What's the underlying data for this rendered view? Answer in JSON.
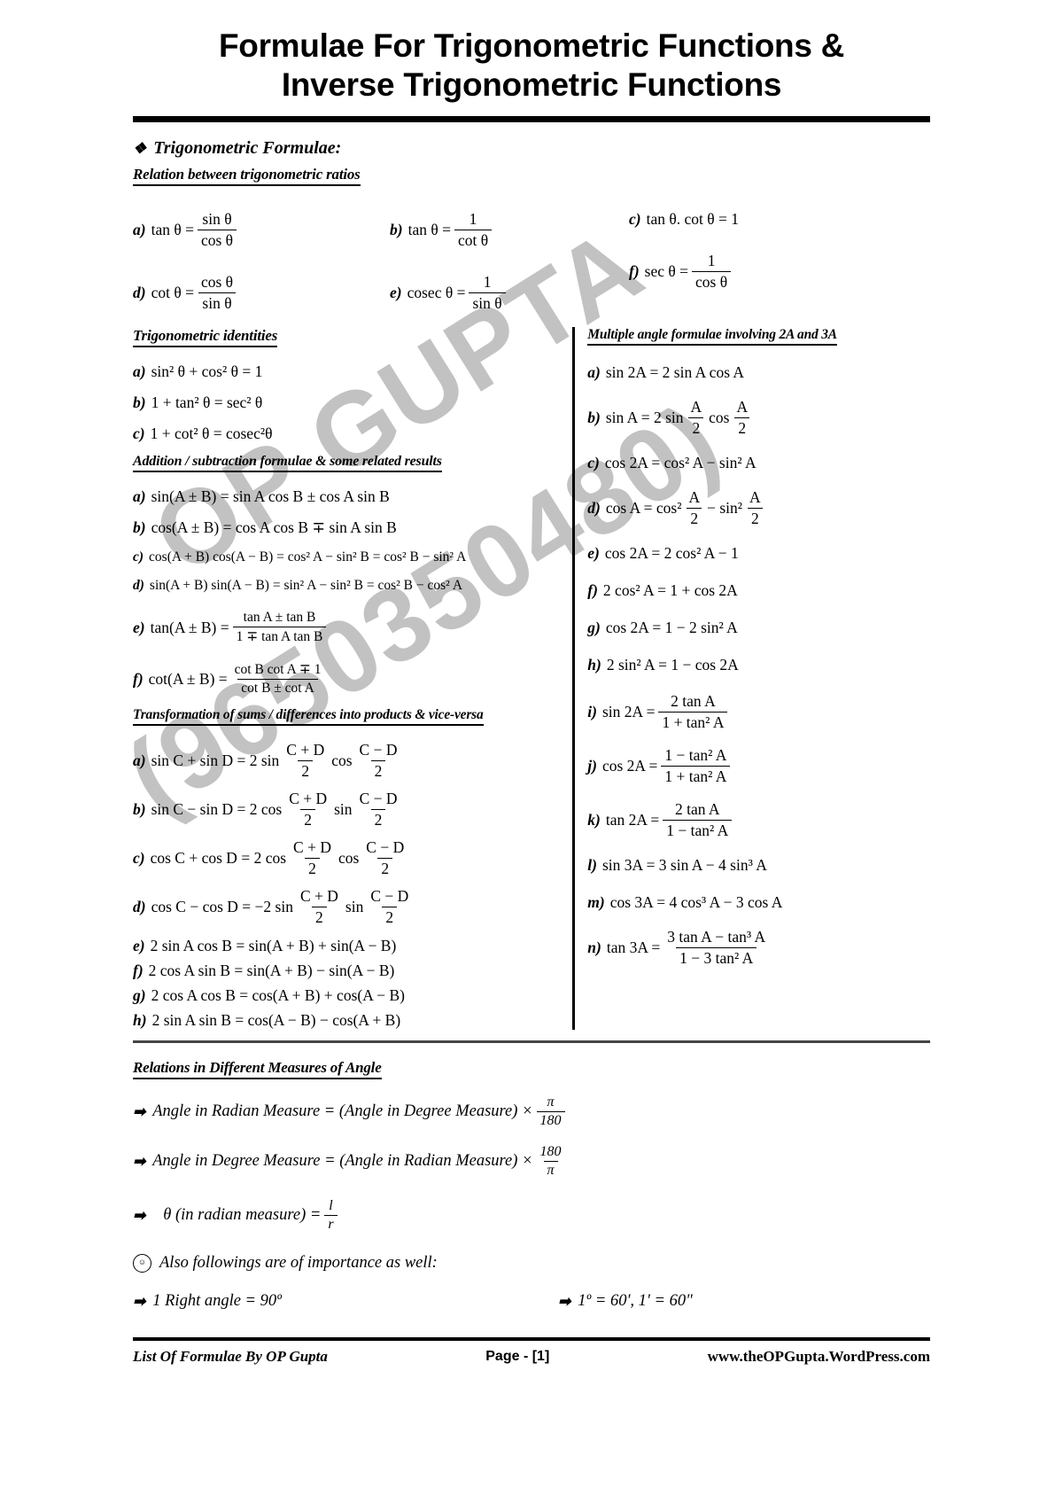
{
  "document": {
    "title_line1": "Formulae For Trigonometric Functions &",
    "title_line2": "Inverse Trigonometric Functions"
  },
  "section_main": {
    "heading": "Trigonometric Formulae:",
    "bullet_glyph": "❖"
  },
  "relations": {
    "subhead": "Relation between trigonometric ratios",
    "items": [
      {
        "label": "a)",
        "lhs": "tan θ =",
        "num": "sin θ",
        "den": "cos θ"
      },
      {
        "label": "b)",
        "lhs": "tan θ =",
        "num": "1",
        "den": "cot θ"
      },
      {
        "label": "c)",
        "plain": "tan θ. cot θ = 1"
      },
      {
        "label": "d)",
        "lhs": "cot θ =",
        "num": "cos θ",
        "den": "sin θ"
      },
      {
        "label": "e)",
        "lhs": "cosec θ =",
        "num": "1",
        "den": "sin θ"
      },
      {
        "label": "f)",
        "lhs": "sec θ =",
        "num": "1",
        "den": "cos θ"
      }
    ]
  },
  "identities": {
    "subhead": "Trigonometric identities",
    "items": [
      {
        "label": "a)",
        "text_html": "sin² θ + cos² θ = 1"
      },
      {
        "label": "b)",
        "text_html": "1 + tan² θ = sec² θ"
      },
      {
        "label": "c)",
        "text_html": "1 + cot² θ = cosec²θ"
      }
    ]
  },
  "addition": {
    "subhead": "Addition / subtraction formulae  & some related results",
    "items": [
      {
        "label": "a)",
        "text": "sin(A ± B) = sin A cos B ± cos A sin B"
      },
      {
        "label": "b)",
        "text": "cos(A ± B) = cos A cos B ∓ sin A sin B"
      },
      {
        "label": "c)",
        "text": "cos(A + B) cos(A − B) = cos² A − sin² B = cos² B − sin² A"
      },
      {
        "label": "d)",
        "text": "sin(A + B) sin(A − B) = sin² A − sin² B = cos² B − cos² A"
      },
      {
        "label": "e)",
        "lhs": "tan(A ± B) =",
        "num": "tan A ± tan B",
        "den": "1 ∓ tan A tan B"
      },
      {
        "label": "f)",
        "lhs": "cot(A ± B) =",
        "num": "cot B cot A ∓ 1",
        "den": "cot B ± cot A"
      }
    ]
  },
  "transformation": {
    "subhead": "Transformation of sums / differences into products & vice-versa",
    "items": [
      {
        "label": "a)",
        "lhs": "sin C + sin D = 2 sin",
        "num1": "C + D",
        "den1": "2",
        "mid": "cos",
        "num2": "C − D",
        "den2": "2"
      },
      {
        "label": "b)",
        "lhs": "sin C − sin D = 2 cos",
        "num1": "C + D",
        "den1": "2",
        "mid": "sin",
        "num2": "C − D",
        "den2": "2"
      },
      {
        "label": "c)",
        "lhs": "cos C + cos D = 2 cos",
        "num1": "C + D",
        "den1": "2",
        "mid": "cos",
        "num2": "C − D",
        "den2": "2"
      },
      {
        "label": "d)",
        "lhs": "cos C − cos D = −2 sin",
        "num1": "C + D",
        "den1": "2",
        "mid": "sin",
        "num2": "C − D",
        "den2": "2"
      },
      {
        "label": "e)",
        "text": "2 sin A cos B = sin(A + B) + sin(A − B)"
      },
      {
        "label": "f)",
        "text": "2 cos A sin B = sin(A + B) − sin(A − B)"
      },
      {
        "label": "g)",
        "text": "2 cos A cos B = cos(A + B) + cos(A − B)"
      },
      {
        "label": "h)",
        "text": "2 sin A sin B = cos(A − B) − cos(A + B)"
      }
    ]
  },
  "multiple_angle": {
    "subhead": "Multiple angle formulae involving 2A and 3A",
    "items": [
      {
        "label": "a)",
        "text": "sin 2A = 2 sin A cos A"
      },
      {
        "label": "b)",
        "lhs": "sin A = 2 sin",
        "num1": "A",
        "den1": "2",
        "mid": "cos",
        "num2": "A",
        "den2": "2"
      },
      {
        "label": "c)",
        "text": "cos 2A = cos² A − sin² A"
      },
      {
        "label": "d)",
        "lhs": "cos A = cos²",
        "num1": "A",
        "den1": "2",
        "mid": "− sin²",
        "num2": "A",
        "den2": "2"
      },
      {
        "label": "e)",
        "text": "cos 2A = 2 cos² A − 1"
      },
      {
        "label": "f)",
        "text": "2 cos² A = 1 + cos 2A"
      },
      {
        "label": "g)",
        "text": "cos 2A = 1 − 2 sin² A"
      },
      {
        "label": "h)",
        "text": "2 sin² A = 1 − cos 2A"
      },
      {
        "label": "i)",
        "lhs": "sin 2A =",
        "num": "2 tan A",
        "den": "1 + tan² A"
      },
      {
        "label": "j)",
        "lhs": "cos 2A =",
        "num": "1 − tan² A",
        "den": "1 + tan² A"
      },
      {
        "label": "k)",
        "lhs": "tan 2A =",
        "num": "2 tan A",
        "den": "1 − tan² A"
      },
      {
        "label": "l)",
        "text": "sin 3A = 3 sin A − 4 sin³ A"
      },
      {
        "label": "m)",
        "text": "cos 3A = 4 cos³ A − 3 cos A"
      },
      {
        "label": "n)",
        "lhs": "tan 3A =",
        "num": "3 tan A − tan³ A",
        "den": "1 − 3 tan² A"
      }
    ]
  },
  "measures": {
    "subhead": "Relations in Different Measures of Angle",
    "bullet_glyph": "➡",
    "items": [
      {
        "lhs": "Angle in Radian Measure = (Angle in Degree Measure) ×",
        "num": "π",
        "den": "180"
      },
      {
        "lhs": "Angle in Degree Measure = (Angle in Radian Measure) ×",
        "num": "180",
        "den": "π"
      },
      {
        "lhs": "θ (in radian measure) =",
        "num": "l",
        "den": "r"
      }
    ],
    "note": "Also followings are of importance as well:",
    "note_icon": "smiley-icon",
    "extra_left": "1 Right angle = 90º",
    "extra_right": "1º = 60', 1' = 60\""
  },
  "footer": {
    "left": "List Of Formulae By OP Gupta",
    "center": "Page - [1]",
    "right": "www.theOPGupta.WordPress.com"
  },
  "watermark": {
    "line1": "OP GUPTA",
    "line2": "(9650350480)"
  }
}
